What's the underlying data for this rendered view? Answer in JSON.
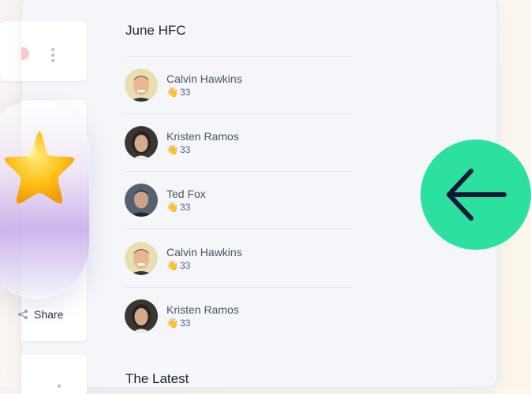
{
  "colors": {
    "fab": "#2ce0a0",
    "arrow": "#111836",
    "panel_bg": "#f4f6fa",
    "star": "#ffc21a"
  },
  "feed": {
    "section_title": "June HFC",
    "people": [
      {
        "name": "Calvin Hawkins",
        "claps": "33",
        "avatar": "avatar-calvin"
      },
      {
        "name": "Kristen Ramos",
        "claps": "33",
        "avatar": "avatar-kristen"
      },
      {
        "name": "Ted Fox",
        "claps": "33",
        "avatar": "avatar-ted"
      },
      {
        "name": "Calvin Hawkins",
        "claps": "33",
        "avatar": "avatar-calvin"
      },
      {
        "name": "Kristen Ramos",
        "claps": "33",
        "avatar": "avatar-kristen"
      }
    ],
    "next_section_title": "The Latest"
  },
  "sidebar": {
    "share_label": "Share"
  },
  "fab": {
    "icon": "arrow-left-icon"
  },
  "decoration": {
    "icon": "star-icon"
  }
}
